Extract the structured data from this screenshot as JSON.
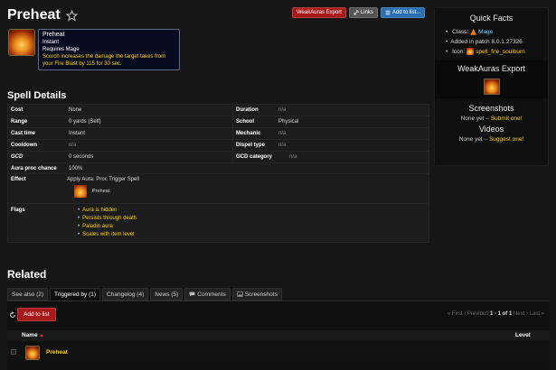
{
  "header": {
    "title": "Preheat",
    "buttons": {
      "weakauras": "WeakAuras Export",
      "links": "Links",
      "add_to_list": "Add to list..."
    }
  },
  "tooltip": {
    "name": "Preheat",
    "cast": "Instant",
    "requires": "Requires Mage",
    "description": "Scorch increases the damage the target takes from your Fire Blast by 115 for 30 sec."
  },
  "quick_facts": {
    "title": "Quick Facts",
    "class_label": "Class:",
    "class_value": "Mage",
    "patch_text": "Added in patch 8.0.1.27326",
    "icon_label": "Icon:",
    "icon_value": "spell_fire_soulburn",
    "weakauras_title": "WeakAuras Export",
    "screenshots_title": "Screenshots",
    "screenshots_none": "None yet –",
    "screenshots_link": "Submit one!",
    "videos_title": "Videos",
    "videos_none": "None yet –",
    "videos_link": "Suggest one!"
  },
  "spell_details": {
    "title": "Spell Details",
    "rows": [
      {
        "l1": "Cost",
        "v1": "None",
        "l2": "Duration",
        "v2": "n/a"
      },
      {
        "l1": "Range",
        "v1": "0 yards (Self)",
        "l2": "School",
        "v2": "Physical"
      },
      {
        "l1": "Cast time",
        "v1": "Instant",
        "l2": "Mechanic",
        "v2": "n/a"
      },
      {
        "l1": "Cooldown",
        "v1": "n/a",
        "l2": "Dispel type",
        "v2": "n/a"
      },
      {
        "l1": "GCD",
        "v1": "0 seconds",
        "l2": "GCD category",
        "v2": "n/a"
      }
    ],
    "aura_proc_label": "Aura proc chance",
    "aura_proc_value": "100%",
    "effect_label": "Effect",
    "effect_value": "Apply Aura: Proc Trigger Spell",
    "effect_spell": "Preheat",
    "flags_label": "Flags",
    "flags": [
      "Aura is hidden",
      "Persists through death",
      "Paladin aura",
      "Scales with item level"
    ]
  },
  "related": {
    "title": "Related",
    "tabs": [
      "See also (2)",
      "Triggered by (1)",
      "Changelog (4)",
      "News (5)",
      "Comments",
      "Screenshots"
    ],
    "add_to_list": "Add to list",
    "pager": {
      "first": "« First",
      "prev": "‹ Previous",
      "range": "1 - 1 of 1",
      "next": "Next ›",
      "last": "Last »"
    },
    "columns": {
      "name": "Name",
      "level": "Level"
    },
    "rows": [
      {
        "name": "Preheat"
      }
    ]
  },
  "colors": {
    "accent": "#ffd100",
    "button_red": "#a71a19",
    "button_blue": "#2a6fb0"
  }
}
